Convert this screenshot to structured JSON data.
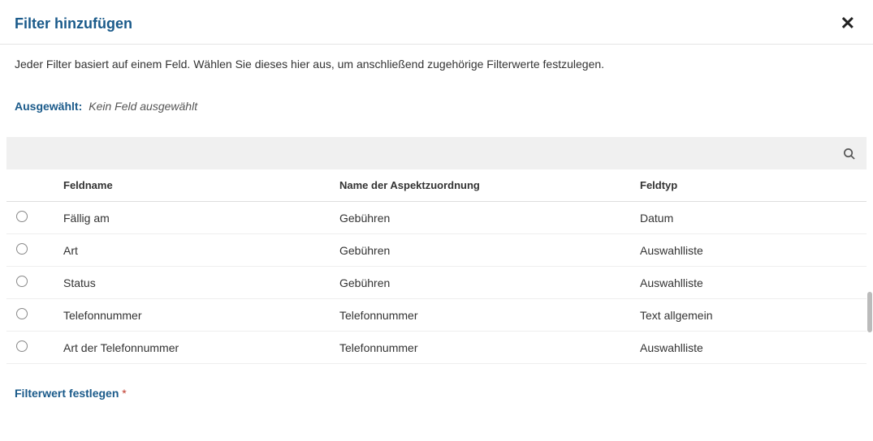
{
  "dialog": {
    "title": "Filter hinzufügen",
    "description": "Jeder Filter basiert auf einem Feld. Wählen Sie dieses hier aus, um anschließend zugehörige Filterwerte festzulegen."
  },
  "selected": {
    "label": "Ausgewählt:",
    "value": "Kein Feld ausgewählt"
  },
  "table": {
    "headers": {
      "feldname": "Feldname",
      "aspekt": "Name der Aspektzuordnung",
      "feldtyp": "Feldtyp"
    },
    "rows": [
      {
        "feldname": "Fällig am",
        "aspekt": "Gebühren",
        "feldtyp": "Datum"
      },
      {
        "feldname": "Art",
        "aspekt": "Gebühren",
        "feldtyp": "Auswahlliste"
      },
      {
        "feldname": "Status",
        "aspekt": "Gebühren",
        "feldtyp": "Auswahlliste"
      },
      {
        "feldname": "Telefonnummer",
        "aspekt": "Telefonnummer",
        "feldtyp": "Text allgemein"
      },
      {
        "feldname": "Art der Telefonnummer",
        "aspekt": "Telefonnummer",
        "feldtyp": "Auswahlliste"
      }
    ]
  },
  "footer": {
    "title": "Filterwert festlegen",
    "required_marker": "*"
  }
}
